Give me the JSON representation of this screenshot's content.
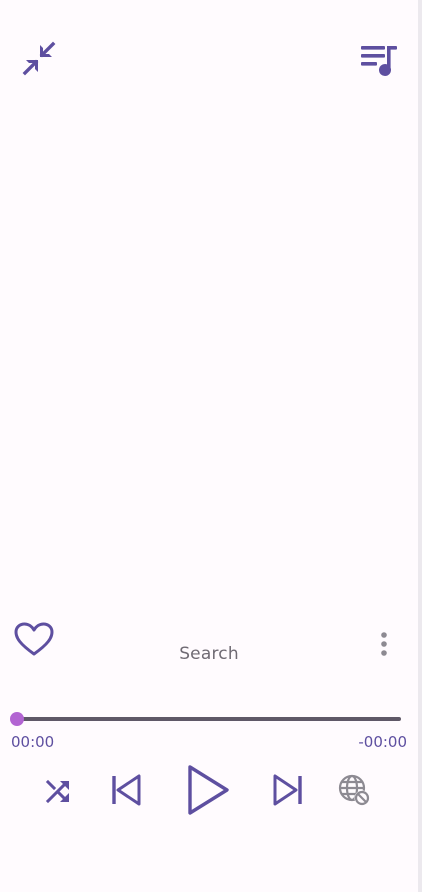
{
  "player": {
    "track_title": "Search",
    "elapsed": "00:00",
    "remaining": "-00:00",
    "progress": 0
  },
  "icons": {
    "collapse": "collapse-arrows-icon",
    "queue": "queue-music-icon",
    "favorite": "heart-outline-icon",
    "more": "more-vertical-icon",
    "shuffle": "shuffle-icon",
    "previous": "skip-previous-icon",
    "play": "play-icon",
    "next": "skip-next-icon",
    "web": "globe-disabled-icon"
  },
  "colors": {
    "accent": "#5e4fa0",
    "progress_thumb": "#b264d2",
    "track": "#5f5867",
    "text_muted": "#6f6a73",
    "disabled_icon": "#8d8a92",
    "background": "#fffbfe"
  }
}
